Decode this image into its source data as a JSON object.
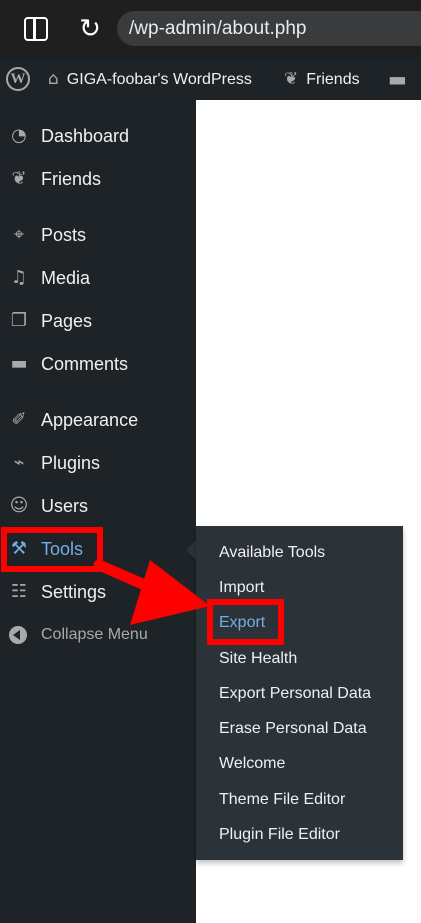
{
  "browser": {
    "url": "/wp-admin/about.php",
    "sidebar_toggle_icon": "sidebar-toggle-icon",
    "reload_icon": "reload-icon"
  },
  "admin_bar": {
    "wp_logo_icon": "wordpress-logo-icon",
    "site_name": "GIGA-foobar's WordPress",
    "friends": "Friends",
    "comments_icon": "comment-bubble-icon"
  },
  "sidebar": {
    "items": [
      {
        "label": "Dashboard",
        "icon": "dashboard-icon"
      },
      {
        "label": "Friends",
        "icon": "friends-icon"
      },
      {
        "label": "Posts",
        "icon": "pin-icon"
      },
      {
        "label": "Media",
        "icon": "media-icon"
      },
      {
        "label": "Pages",
        "icon": "pages-icon"
      },
      {
        "label": "Comments",
        "icon": "comment-icon"
      },
      {
        "label": "Appearance",
        "icon": "paintbrush-icon"
      },
      {
        "label": "Plugins",
        "icon": "plug-icon"
      },
      {
        "label": "Users",
        "icon": "user-icon"
      },
      {
        "label": "Tools",
        "icon": "wrench-icon"
      },
      {
        "label": "Settings",
        "icon": "settings-sliders-icon"
      }
    ],
    "collapse_label": "Collapse Menu"
  },
  "submenu": {
    "items": [
      "Available Tools",
      "Import",
      "Export",
      "Site Health",
      "Export Personal Data",
      "Erase Personal Data",
      "Welcome",
      "Theme File Editor",
      "Plugin File Editor"
    ],
    "highlighted": "Export"
  },
  "colors": {
    "admin_bg": "#1d2327",
    "submenu_bg": "#2c3338",
    "accent": "#72aee6",
    "annotation": "#ff0000"
  }
}
